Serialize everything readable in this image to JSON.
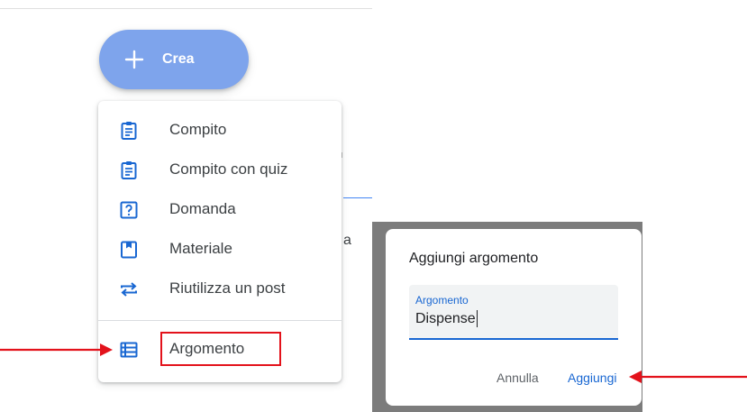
{
  "create_button": {
    "label": "Crea",
    "icon": "plus-icon"
  },
  "menu": {
    "items": [
      {
        "label": "Compito",
        "icon": "assignment-icon"
      },
      {
        "label": "Compito con quiz",
        "icon": "quiz-assignment-icon"
      },
      {
        "label": "Domanda",
        "icon": "question-icon"
      },
      {
        "label": "Materiale",
        "icon": "material-icon"
      },
      {
        "label": "Riutilizza un post",
        "icon": "reuse-icon"
      },
      {
        "label": "Argomento",
        "icon": "topic-icon"
      }
    ]
  },
  "background": {
    "partial_text": "a"
  },
  "dialog": {
    "title": "Aggiungi argomento",
    "field_label": "Argomento",
    "field_value": "Dispense",
    "cancel_label": "Annulla",
    "add_label": "Aggiungi"
  },
  "colors": {
    "accent": "#1967d2",
    "crea_button": "#7ea4ec",
    "annotation_red": "#e3121b",
    "overlay": "#7c7c7c"
  }
}
